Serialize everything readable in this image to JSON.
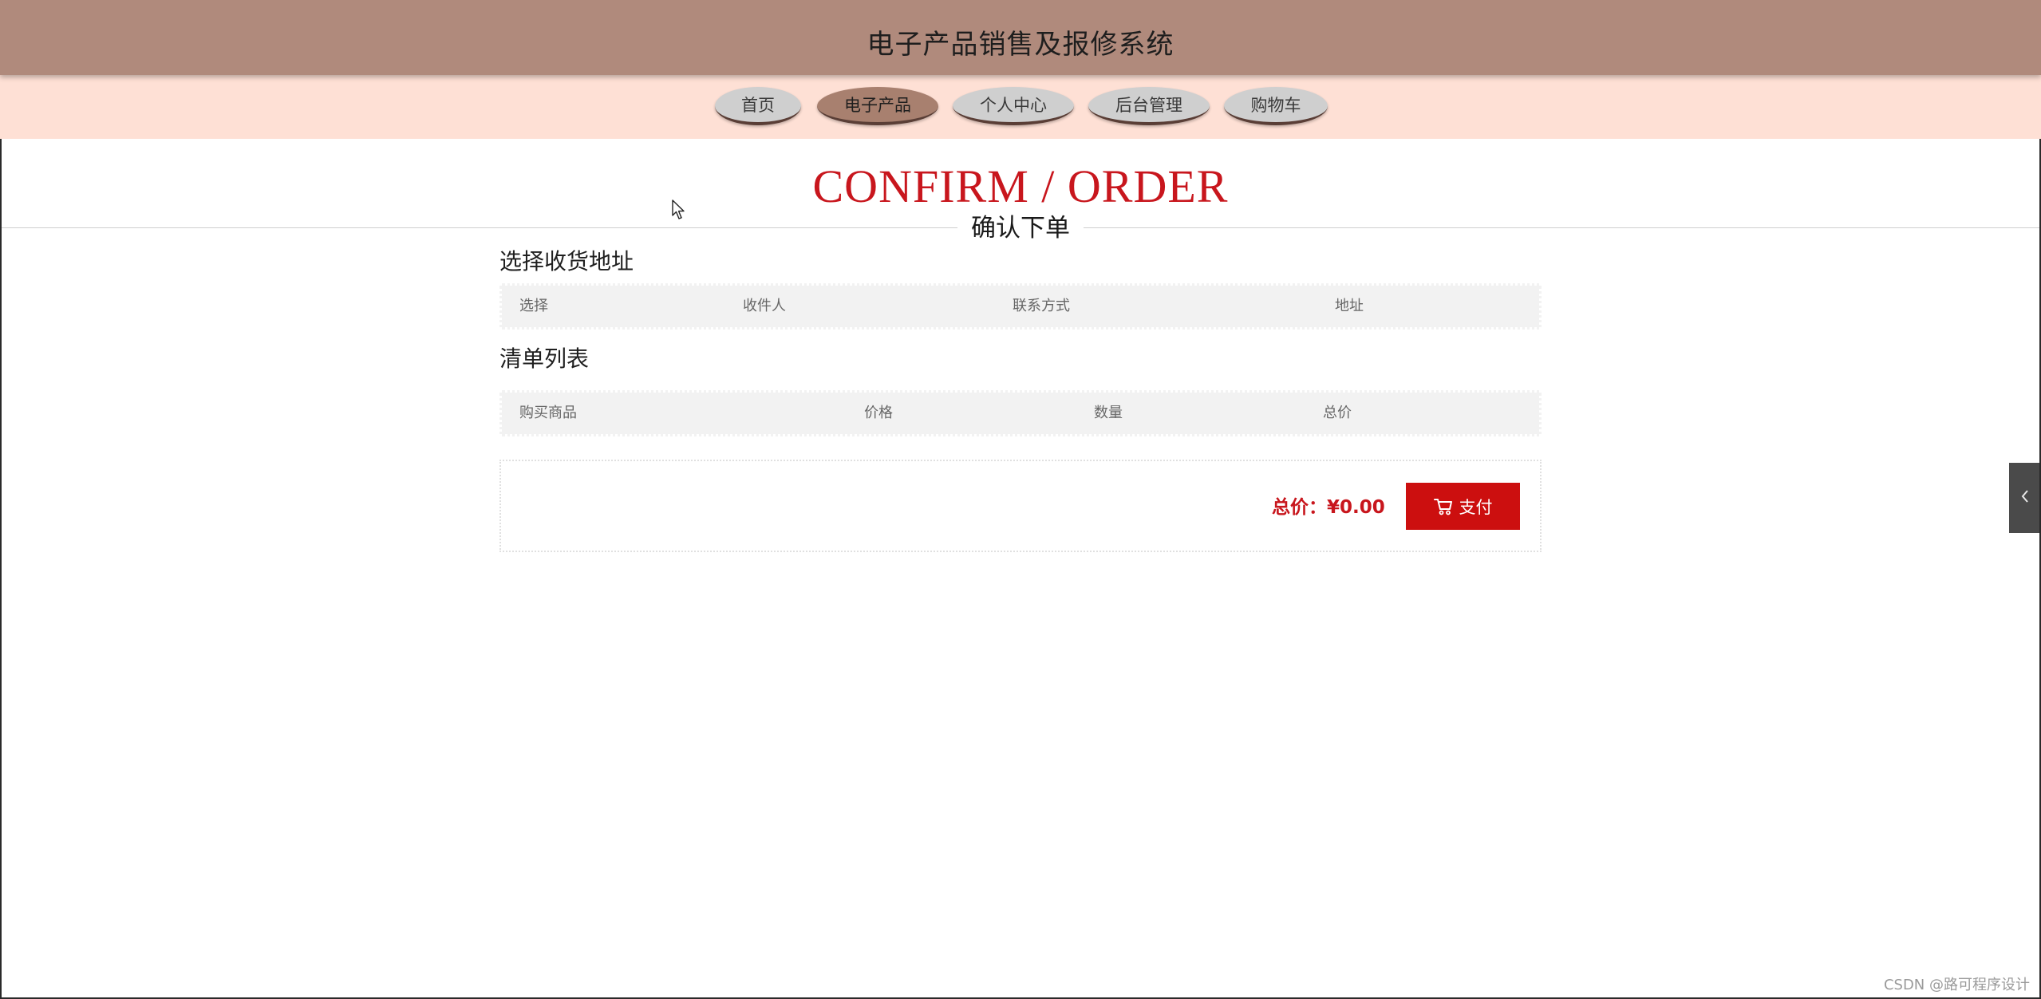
{
  "header": {
    "title": "电子产品销售及报修系统"
  },
  "nav": {
    "items": [
      {
        "label": "首页"
      },
      {
        "label": "电子产品"
      },
      {
        "label": "个人中心"
      },
      {
        "label": "后台管理"
      },
      {
        "label": "购物车"
      }
    ],
    "active_index": 1
  },
  "page": {
    "heading_en": "CONFIRM / ORDER",
    "heading_cn": "确认下单"
  },
  "address_section": {
    "title": "选择收货地址",
    "columns": [
      "选择",
      "收件人",
      "联系方式",
      "地址"
    ]
  },
  "order_list": {
    "title": "清单列表",
    "columns": [
      "购买商品",
      "价格",
      "数量",
      "总价"
    ]
  },
  "summary": {
    "total_label": "总价：",
    "total_value": "¥0.00",
    "pay_label": "支付"
  },
  "icons": {
    "pay_button": "cart-icon",
    "side_toggle": "chevron-left-icon",
    "cursor": "mouse-pointer-icon"
  },
  "colors": {
    "header_bg": "#b08a7c",
    "nav_bg": "#fee0d5",
    "nav_item_bg": "#cfcfcf",
    "nav_item_active_bg": "#a8806f",
    "accent_red": "#c8161d",
    "pay_button_bg": "#cc0f0f",
    "side_toggle_bg": "#4a4a4a"
  },
  "watermark": "CSDN @路可程序设计"
}
